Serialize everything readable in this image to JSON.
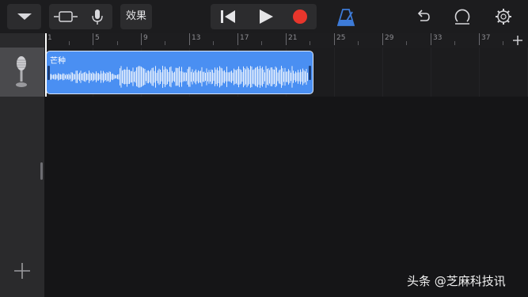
{
  "toolbar": {
    "effects_label": "效果"
  },
  "ruler": {
    "bars": [
      "1",
      "5",
      "9",
      "13",
      "17",
      "21",
      "25",
      "29",
      "33",
      "37"
    ]
  },
  "track": {
    "region_name": "芒种"
  },
  "colors": {
    "record": "#e8362c",
    "metronome": "#3d7bd8",
    "region": "#4a8ff2"
  },
  "icons": [
    "dropdown-icon",
    "tracks-view-icon",
    "microphone-icon",
    "rewind-icon",
    "play-icon",
    "record-icon",
    "metronome-icon",
    "undo-icon",
    "loop-icon",
    "settings-icon",
    "add-section-icon",
    "add-track-icon"
  ],
  "watermark": "头条 @芝麻科技讯"
}
